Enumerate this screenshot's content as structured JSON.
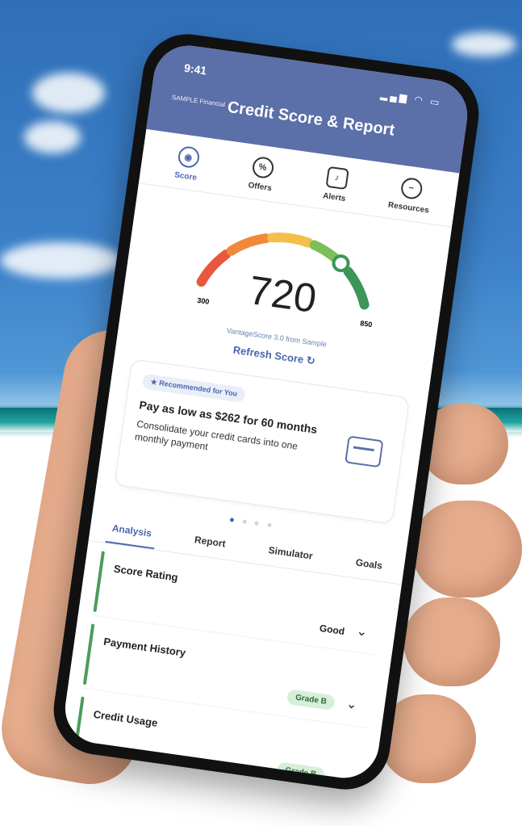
{
  "status": {
    "time": "9:41",
    "icons": "signal wifi battery"
  },
  "header": {
    "brand": "SAMPLE Financial",
    "title": "Credit Score & Report"
  },
  "top_tabs": [
    {
      "label": "Score",
      "icon": "score-icon"
    },
    {
      "label": "Offers",
      "icon": "offers-icon"
    },
    {
      "label": "Alerts",
      "icon": "bell-icon"
    },
    {
      "label": "Resources",
      "icon": "resources-icon"
    }
  ],
  "gauge": {
    "score": "720",
    "min": "300",
    "max": "850",
    "score_value": 720,
    "range": [
      300,
      850
    ],
    "segment_colors": [
      "#e8583e",
      "#f08a3a",
      "#f2c04a",
      "#7bbf57",
      "#3d9658"
    ],
    "provider": "VantageScore 3.0 from Sample",
    "refresh_label": "Refresh Score"
  },
  "recommendation": {
    "badge": "Recommended for You",
    "title": "Pay as low as $262 for 60 months",
    "subtitle": "Consolidate your credit cards into one monthly payment"
  },
  "carousel": {
    "page": 1,
    "total": 4
  },
  "bottom_tabs": [
    "Analysis",
    "Report",
    "Simulator",
    "Goals"
  ],
  "factors": [
    {
      "label": "Score Rating",
      "value": "Good",
      "pill": ""
    },
    {
      "label": "Payment History",
      "value": "",
      "pill": "Grade B"
    },
    {
      "label": "Credit Usage",
      "value": "",
      "pill": "Grade B"
    }
  ],
  "colors": {
    "header": "#5b6fa8",
    "accent": "#4a66b0",
    "good": "#3d9658"
  }
}
